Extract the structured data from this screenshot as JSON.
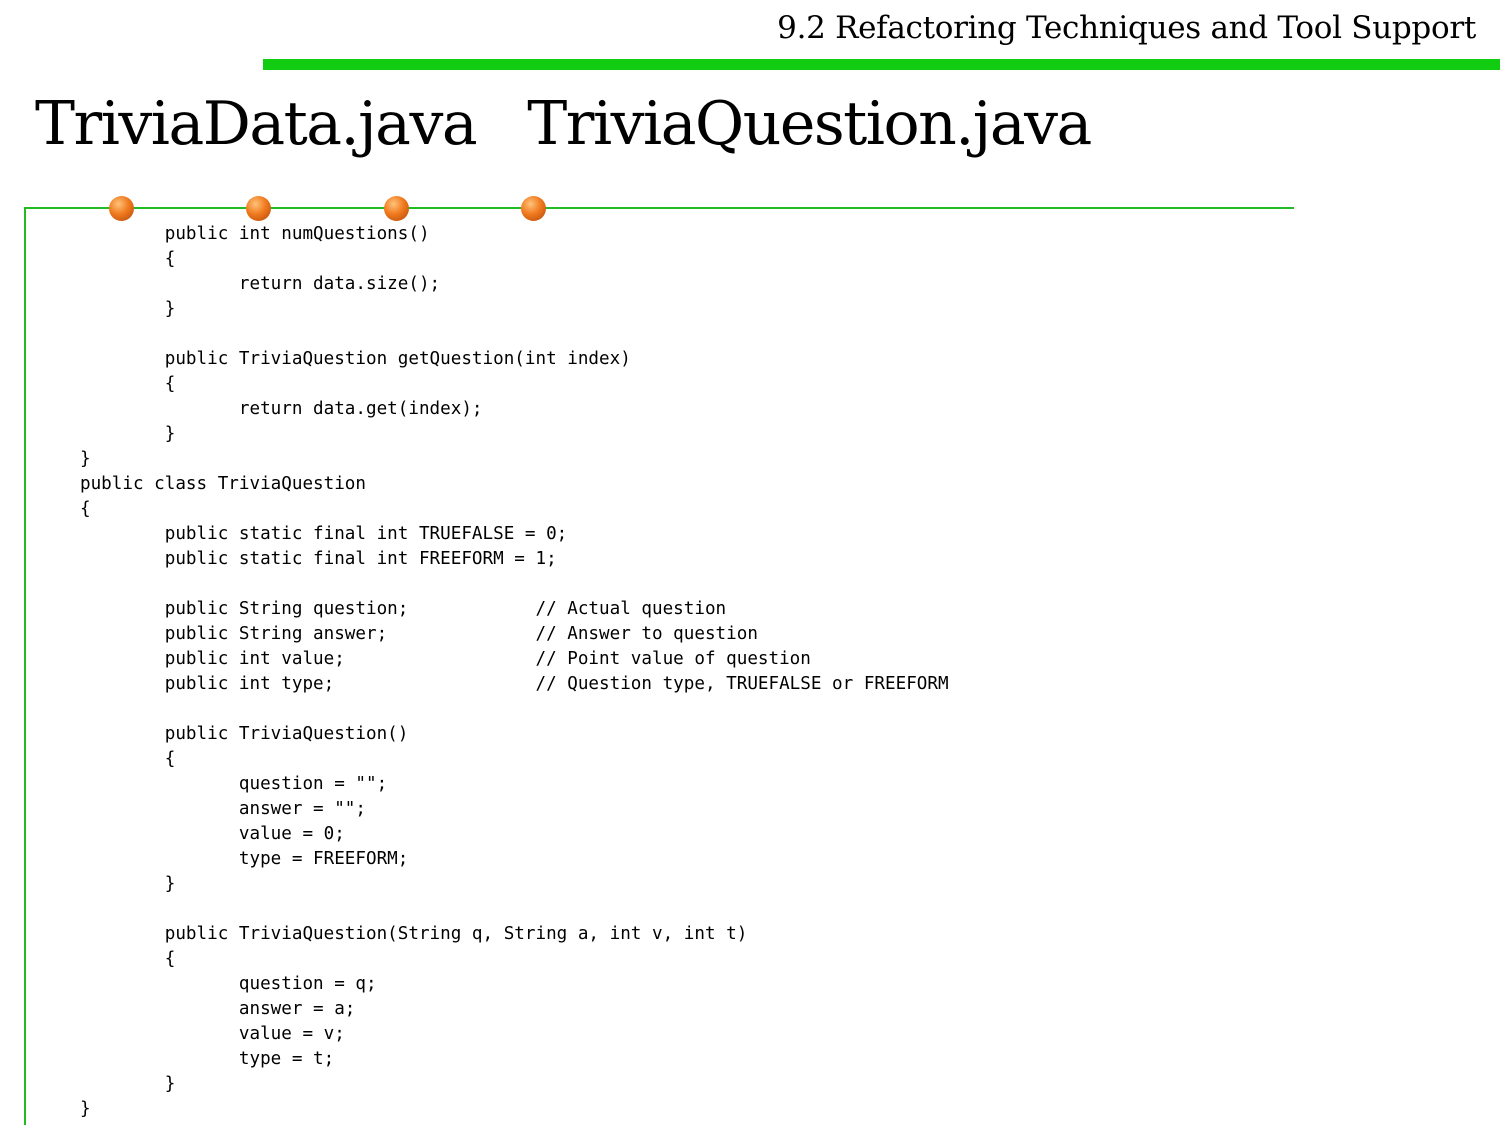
{
  "header": {
    "section_title": "9.2 Refactoring Techniques and Tool Support"
  },
  "slide": {
    "title": "TriviaData.java  TriviaQuestion.java"
  },
  "colors": {
    "accent_green": "#11cc11",
    "bullet_orange": "#f07a1e"
  },
  "code_lines": [
    "\t\tpublic int numQuestions()",
    "\t\t{",
    "\t\t\t\treturn data.size();",
    "\t\t}",
    "",
    "\t\tpublic TriviaQuestion getQuestion(int index)",
    "\t\t{",
    "\t\t\t\treturn data.get(index);",
    "\t\t}",
    "}",
    "public class TriviaQuestion",
    "{",
    "\t\tpublic static final int TRUEFALSE = 0;",
    "\t\tpublic static final int FREEFORM = 1;",
    "",
    "\t\tpublic String question;\t\t\t\t// Actual question",
    "\t\tpublic String answer;\t\t\t\t// Answer to question",
    "\t\tpublic int value;\t\t\t\t\t\t// Point value of question",
    "\t\tpublic int type;\t\t\t\t\t\t// Question type, TRUEFALSE or FREEFORM",
    "",
    "\t\tpublic TriviaQuestion()",
    "\t\t{",
    "\t\t\t\tquestion = \"\";",
    "\t\t\t\tanswer = \"\";",
    "\t\t\t\tvalue = 0;",
    "\t\t\t\ttype = FREEFORM;",
    "\t\t}",
    "",
    "\t\tpublic TriviaQuestion(String q, String a, int v, int t)",
    "\t\t{",
    "\t\t\t\tquestion = q;",
    "\t\t\t\tanswer = a;",
    "\t\t\t\tvalue = v;",
    "\t\t\t\ttype = t;",
    "\t\t}",
    "}"
  ]
}
